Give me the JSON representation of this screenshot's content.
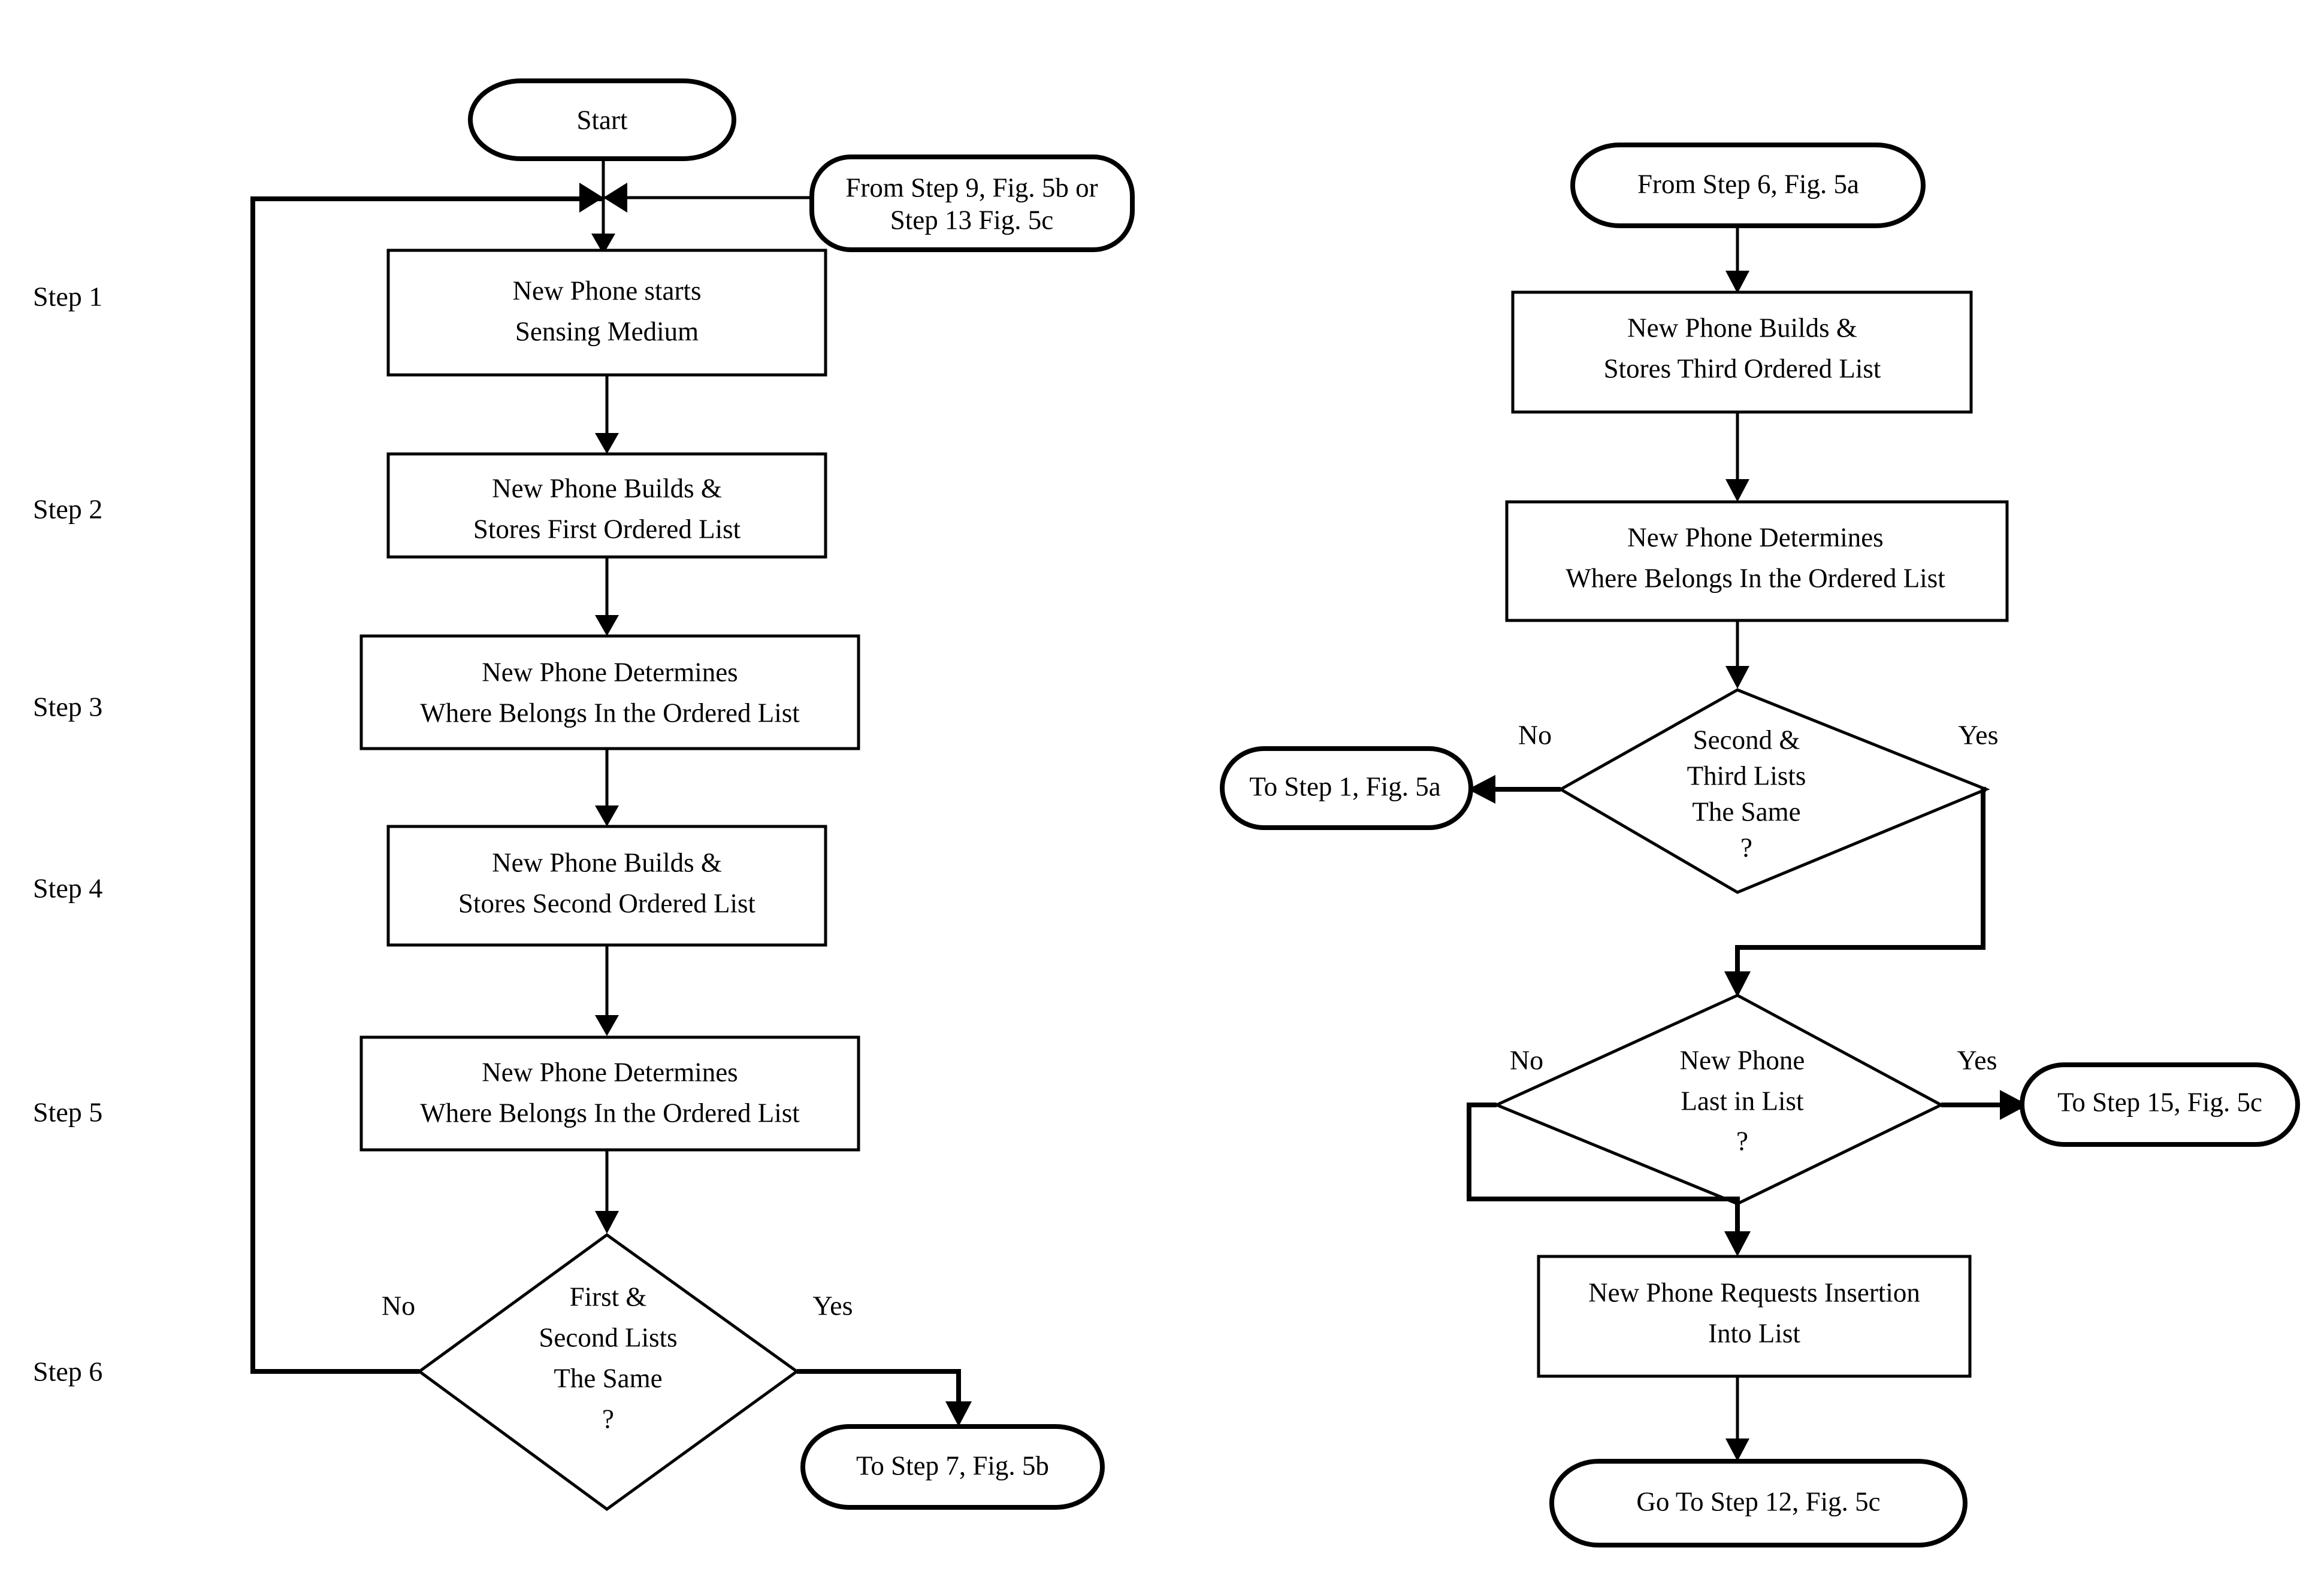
{
  "figure": {
    "type": "flowchart",
    "orientation": "two-column",
    "background_color": "#ffffff",
    "line_color": "#000000"
  },
  "step_labels": [
    {
      "id": "step-1",
      "text": "Step 1"
    },
    {
      "id": "step-2",
      "text": "Step 2"
    },
    {
      "id": "step-3",
      "text": "Step 3"
    },
    {
      "id": "step-4",
      "text": "Step 4"
    },
    {
      "id": "step-5",
      "text": "Step 5"
    },
    {
      "id": "step-6",
      "text": "Step 6"
    }
  ],
  "left_column": {
    "start_terminal": {
      "label": "Start",
      "shape": "terminator"
    },
    "entry_connector": {
      "line1": "From Step 9, Fig. 5b or",
      "line2": "Step 13 Fig. 5c",
      "shape": "terminator"
    },
    "process_nodes": [
      {
        "id": "p1",
        "line1": "New Phone starts",
        "line2": "Sensing Medium",
        "shape": "process"
      },
      {
        "id": "p2",
        "line1": "New Phone Builds &",
        "line2": "Stores First Ordered List",
        "shape": "process"
      },
      {
        "id": "p3",
        "line1": "New Phone Determines",
        "line2": "Where Belongs In the Ordered List",
        "shape": "process"
      },
      {
        "id": "p4",
        "line1": "New Phone Builds &",
        "line2": "Stores Second Ordered List",
        "shape": "process"
      },
      {
        "id": "p5",
        "line1": "New Phone Determines",
        "line2": "Where Belongs In the Ordered List",
        "shape": "process"
      }
    ],
    "decision": {
      "id": "d1",
      "line1": "First &",
      "line2": "Second Lists",
      "line3": "The Same",
      "line4": "?",
      "shape": "decision",
      "no_label": "No",
      "yes_label": "Yes"
    },
    "exit_terminal": {
      "label": "To Step 7, Fig. 5b",
      "shape": "terminator"
    }
  },
  "right_column": {
    "entry_terminal": {
      "label": "From Step 6, Fig. 5a",
      "shape": "terminator"
    },
    "process_nodes": [
      {
        "id": "r1",
        "line1": "New Phone Builds &",
        "line2": "Stores Third Ordered List",
        "shape": "process"
      },
      {
        "id": "r2",
        "line1": "New Phone Determines",
        "line2": "Where Belongs In the Ordered List",
        "shape": "process"
      },
      {
        "id": "r3",
        "line1": "New Phone Requests Insertion",
        "line2": "Into List",
        "shape": "process"
      }
    ],
    "decisions": [
      {
        "id": "rd1",
        "line1": "Second &",
        "line2": "Third Lists",
        "line3": "The Same",
        "line4": "?",
        "shape": "decision",
        "no_label": "No",
        "yes_label": "Yes"
      },
      {
        "id": "rd2",
        "line1": "New Phone",
        "line2": "Last in List",
        "line3": "?",
        "shape": "decision",
        "no_label": "No",
        "yes_label": "Yes"
      }
    ],
    "exit_terminals": [
      {
        "id": "rt1",
        "label": "To Step 1, Fig. 5a",
        "shape": "terminator"
      },
      {
        "id": "rt2",
        "label": "To Step 15, Fig. 5c",
        "shape": "terminator"
      },
      {
        "id": "rt3",
        "label": "Go To Step 12, Fig. 5c",
        "shape": "terminator"
      }
    ]
  }
}
